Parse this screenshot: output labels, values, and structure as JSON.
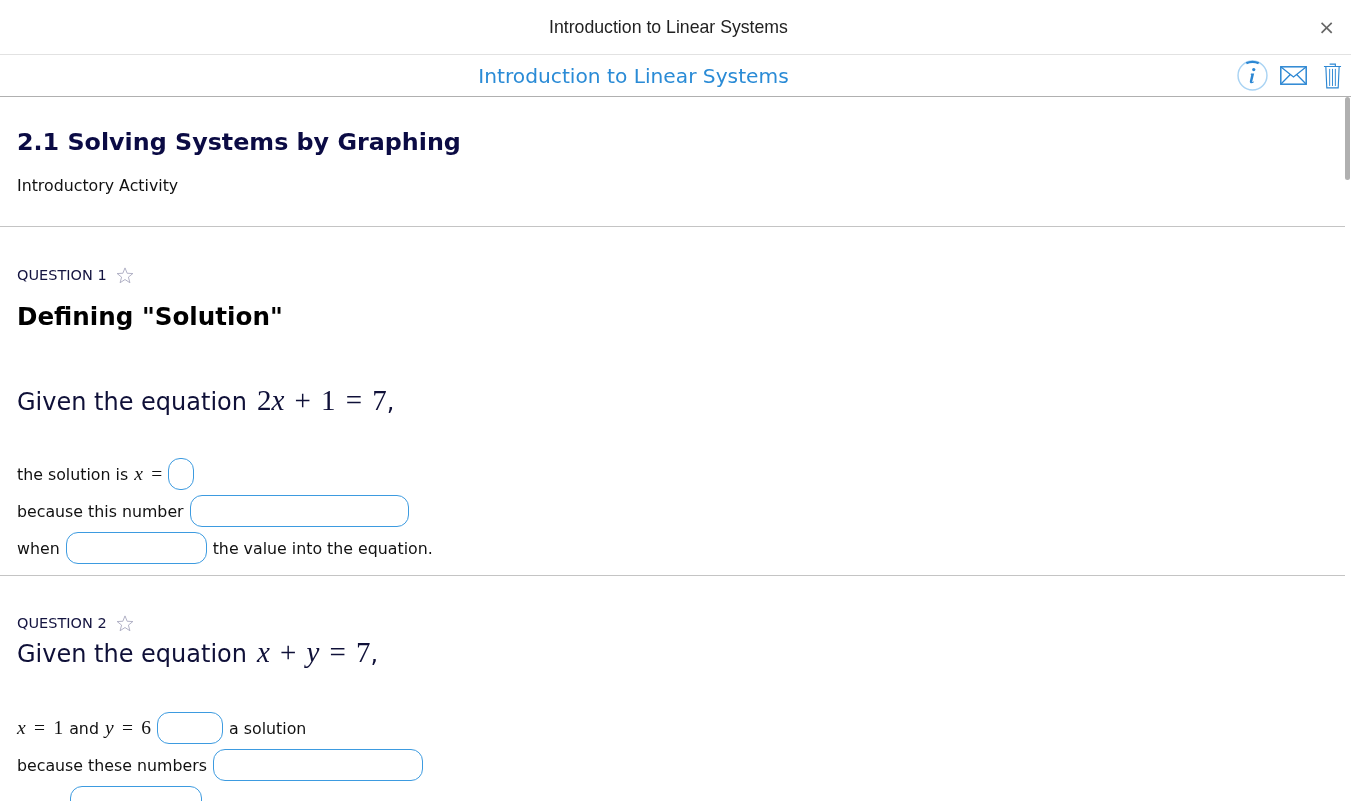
{
  "window": {
    "title": "Introduction to Linear Systems",
    "close": "×"
  },
  "toolbar": {
    "title": "Introduction to Linear Systems"
  },
  "section": {
    "heading": "2.1 Solving Systems by Graphing",
    "subtitle": "Introductory Activity"
  },
  "questions": [
    {
      "label": "QUESTION 1",
      "starred": false,
      "title": "Defining \"Solution\"",
      "prompt": [
        {
          "kind": "text",
          "text": "Given the equation"
        },
        {
          "kind": "math",
          "tokens": [
            {
              "text": "2",
              "italic": false
            },
            {
              "text": "x",
              "italic": true
            },
            {
              "text": " + 1 = 7",
              "italic": false
            }
          ]
        },
        {
          "kind": "punct",
          "text": ","
        }
      ],
      "lines": [
        {
          "parts": [
            {
              "kind": "text",
              "text": "the solution is"
            },
            {
              "kind": "math",
              "tokens": [
                {
                  "text": "x",
                  "italic": true
                },
                {
                  "text": " =",
                  "italic": false
                }
              ]
            },
            {
              "kind": "blank"
            }
          ]
        },
        {
          "parts": [
            {
              "kind": "text",
              "text": "because this number"
            },
            {
              "kind": "blank"
            }
          ]
        },
        {
          "parts": [
            {
              "kind": "text",
              "text": "when"
            },
            {
              "kind": "blank"
            },
            {
              "kind": "text",
              "text": "the value into the equation."
            }
          ]
        }
      ]
    },
    {
      "label": "QUESTION 2",
      "starred": false,
      "prompt": [
        {
          "kind": "text",
          "text": "Given the equation"
        },
        {
          "kind": "math",
          "tokens": [
            {
              "text": "x",
              "italic": true
            },
            {
              "text": " + ",
              "italic": false
            },
            {
              "text": "y",
              "italic": true
            },
            {
              "text": " = 7",
              "italic": false
            }
          ]
        },
        {
          "kind": "punct",
          "text": ","
        }
      ],
      "lines": [
        {
          "parts": [
            {
              "kind": "math",
              "tokens": [
                {
                  "text": "x",
                  "italic": true
                },
                {
                  "text": " = 1",
                  "italic": false
                }
              ]
            },
            {
              "kind": "text",
              "text": "and"
            },
            {
              "kind": "math",
              "tokens": [
                {
                  "text": "y",
                  "italic": true
                },
                {
                  "text": " = 6",
                  "italic": false
                }
              ]
            },
            {
              "kind": "blank"
            },
            {
              "kind": "text",
              "text": "a solution"
            }
          ]
        },
        {
          "parts": [
            {
              "kind": "text",
              "text": "because these numbers"
            },
            {
              "kind": "blank"
            }
          ]
        },
        {
          "parts": [
            {
              "kind": "blank"
            }
          ]
        }
      ]
    }
  ]
}
